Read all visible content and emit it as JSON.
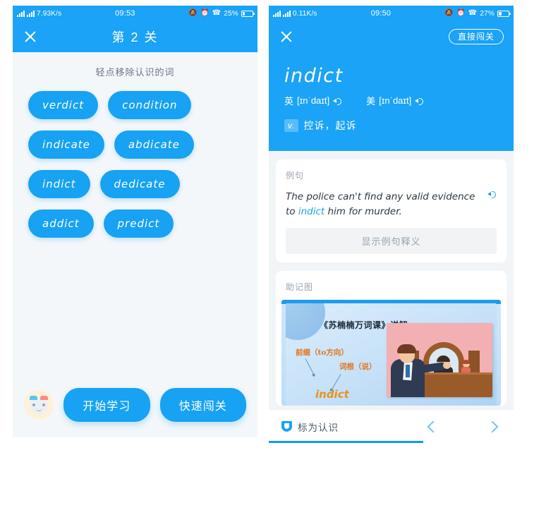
{
  "quiz_screen": {
    "status_bar": {
      "network_speed": "7.93K/s",
      "time": "09:53",
      "battery_percent": "25%"
    },
    "nav": {
      "close_icon": "close-icon",
      "title": "第 2 关"
    },
    "hint": "轻点移除认识的词",
    "words": [
      "verdict",
      "condition",
      "indicate",
      "abdicate",
      "indict",
      "dedicate",
      "addict",
      "predict"
    ],
    "footer": {
      "avatar": "robot-avatar",
      "start_label": "开始学习",
      "quick_label": "快速闯关"
    }
  },
  "word_screen": {
    "status_bar": {
      "network_speed": "0.11K/s",
      "time": "09:50",
      "battery_percent": "27%"
    },
    "nav": {
      "close_icon": "close-icon",
      "skip_label": "直接闯关"
    },
    "headword": "indict",
    "phonetics": [
      {
        "region": "英",
        "ipa": "[ɪnˈdaɪt]"
      },
      {
        "region": "美",
        "ipa": "[ɪnˈdaɪt]"
      }
    ],
    "definition": {
      "pos": "v.",
      "meaning": "控诉，起诉"
    },
    "example_card": {
      "label": "例句",
      "sentence_before": "The police can't find any valid evidence to ",
      "sentence_highlight": "indict",
      "sentence_after": " him for murder.",
      "reveal_label": "显示例句释义"
    },
    "mnemonic_card": {
      "label": "助记图",
      "image_heading": "《苏楠楠万词课》详解:",
      "anno_prefix": "前缀（to方向）",
      "anno_root": "词根（说）",
      "anno_word": "indict"
    },
    "bottom": {
      "mark_known_label": "标为认识",
      "prev_icon": "chevron-left-icon",
      "next_icon": "chevron-right-icon",
      "progress_percent": 63
    }
  },
  "colors": {
    "brand_blue": "#1aa3f7",
    "bubble_blue": "#17a2f3",
    "page_bg": "#f2f5f8",
    "accent_orange": "#e8921f"
  }
}
